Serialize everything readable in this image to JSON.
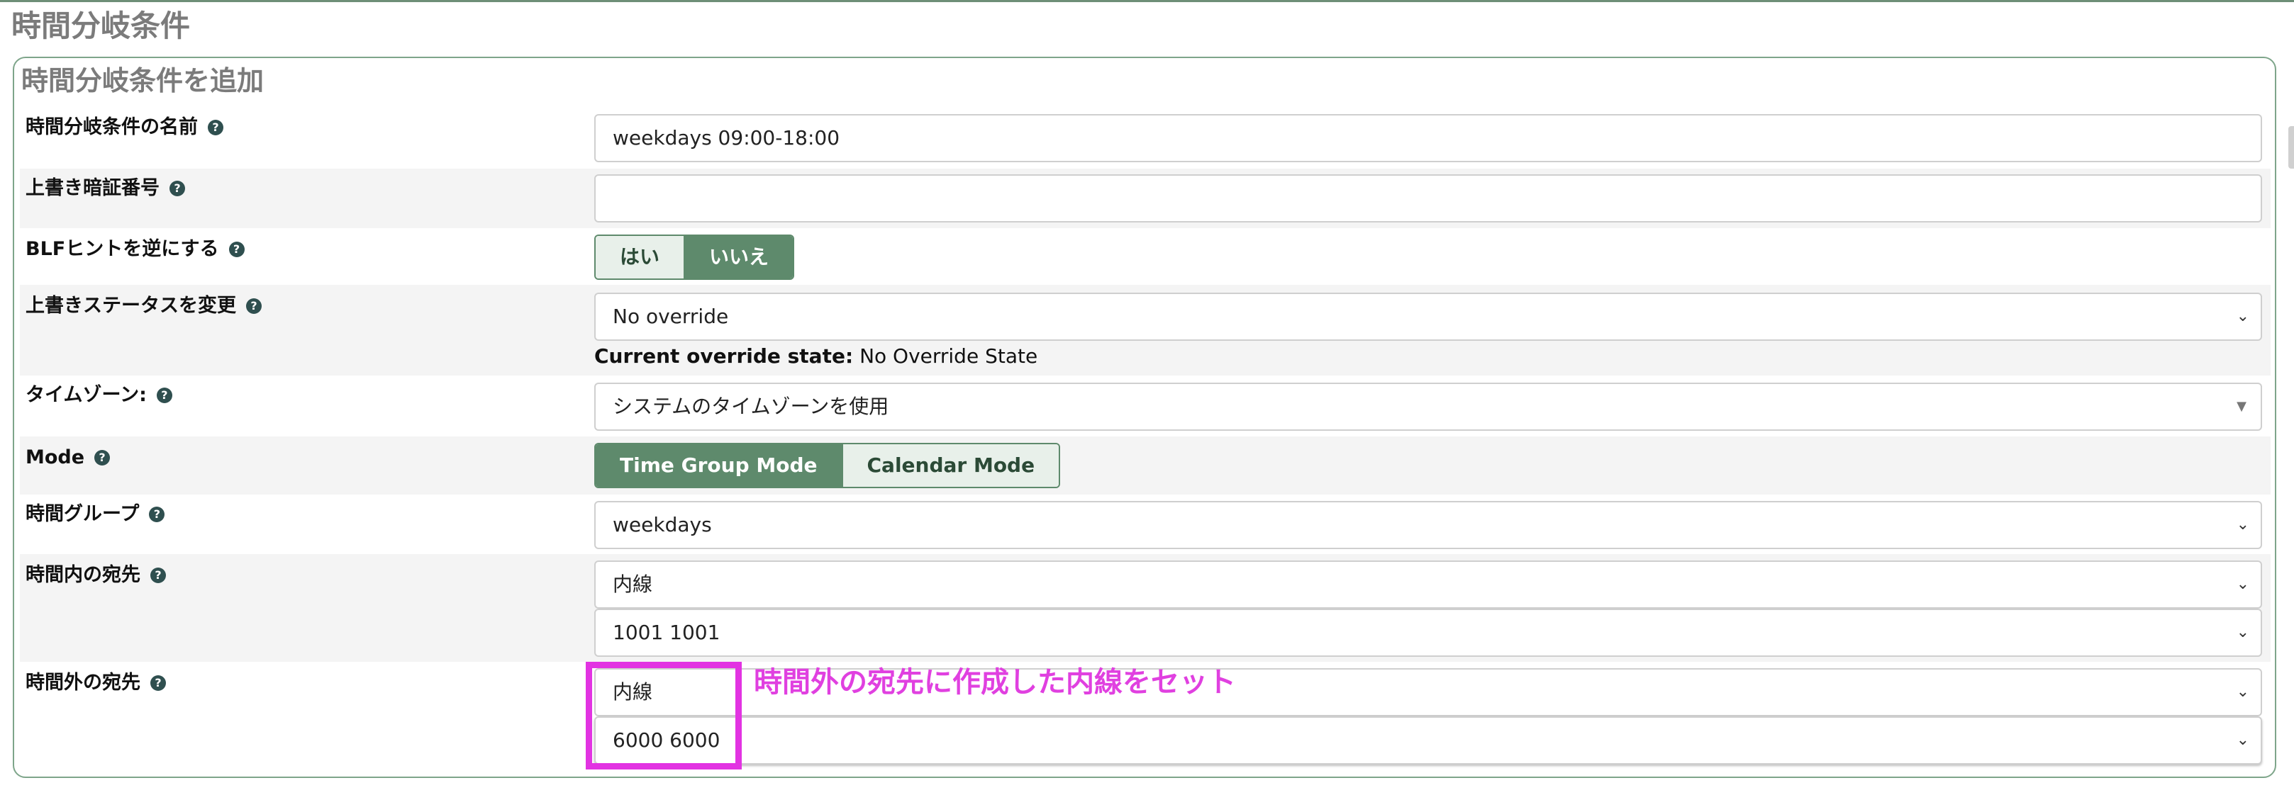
{
  "page_title": "時間分岐条件",
  "section_title": "時間分岐条件を追加",
  "fields": {
    "name": {
      "label": "時間分岐条件の名前",
      "value": "weekdays 09:00-18:00"
    },
    "override_code": {
      "label": "上書き暗証番号",
      "value": ""
    },
    "blf_invert": {
      "label": "BLFヒントを逆にする",
      "options": [
        "はい",
        "いいえ"
      ],
      "selected": "いいえ"
    },
    "override_state": {
      "label": "上書きステータスを変更",
      "value": "No override",
      "current_label": "Current override state:",
      "current_value": "No Override State"
    },
    "timezone": {
      "label": "タイムゾーン:",
      "value": "システムのタイムゾーンを使用"
    },
    "mode": {
      "label": "Mode",
      "options": [
        "Time Group Mode",
        "Calendar Mode"
      ],
      "selected": "Time Group Mode"
    },
    "time_group": {
      "label": "時間グループ",
      "value": "weekdays"
    },
    "dest_in": {
      "label": "時間内の宛先",
      "type_value": "内線",
      "target_value": "1001 1001"
    },
    "dest_out": {
      "label": "時間外の宛先",
      "type_value": "内線",
      "target_value": "6000 6000"
    }
  },
  "annotation": "時間外の宛先に作成した内線をセット",
  "colors": {
    "accent": "#5e8a6c",
    "highlight": "#e233e2",
    "help_icon": "#2f4f4f"
  }
}
